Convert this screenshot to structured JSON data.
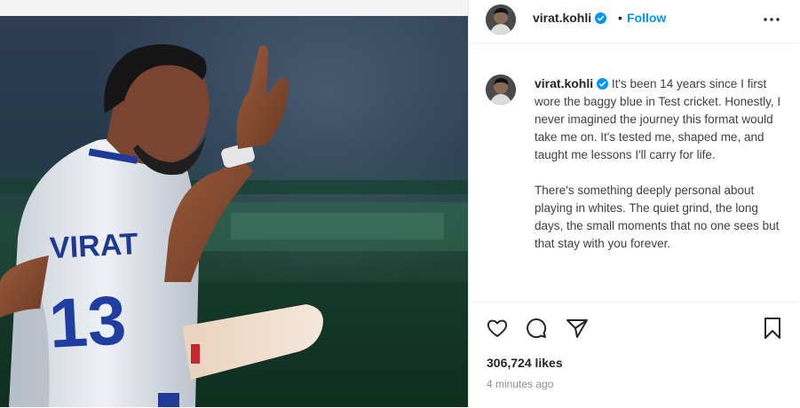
{
  "post": {
    "username": "virat.kohli",
    "follow_label": "Follow",
    "separator": "•",
    "caption_paragraph_1": "It's been 14 years since I first wore the baggy blue in Test cricket. Honestly, I never imagined the journey this format would take me on. It's tested me, shaped me, and taught me lessons I'll carry for life.",
    "caption_paragraph_2": "There's something deeply personal about playing in whites. The quiet grind, the long days, the small moments that no one sees but that stay with you forever.",
    "likes": "306,724 likes",
    "timestamp": "4 minutes ago",
    "jersey_name": "VIRAT",
    "jersey_number": "13"
  },
  "icons": {
    "verified": "verified-badge-icon",
    "more": "more-options-icon",
    "like": "heart-icon",
    "comment": "comment-icon",
    "share": "share-icon",
    "save": "bookmark-icon"
  },
  "colors": {
    "link_blue": "#0095f6",
    "text_dark": "#262626",
    "text_muted": "#8e8e8e"
  }
}
